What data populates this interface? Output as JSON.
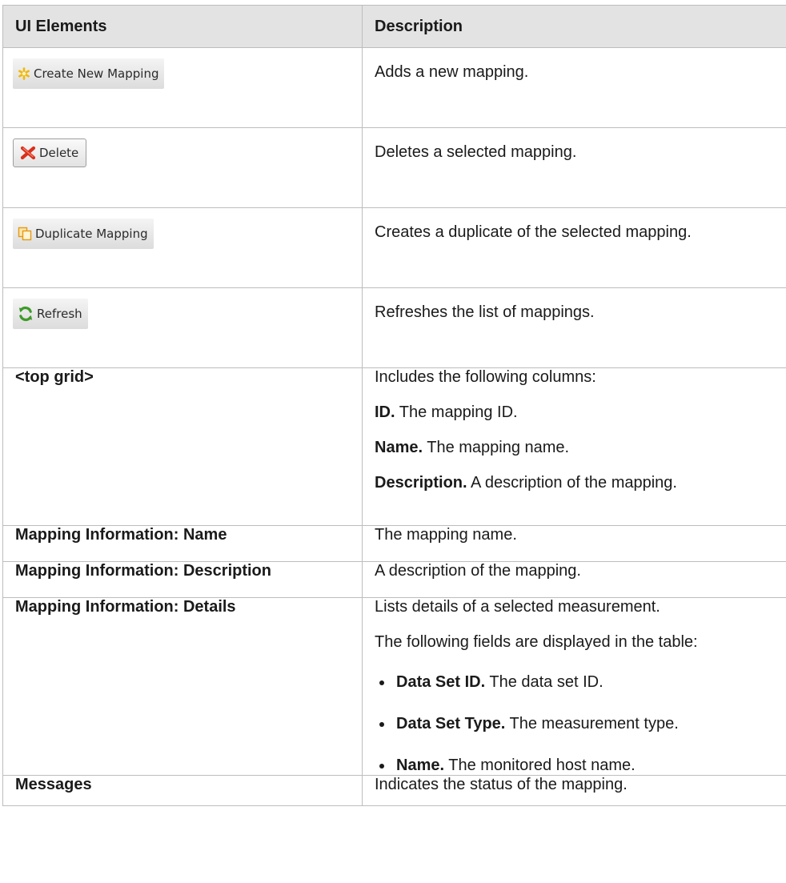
{
  "header": {
    "col1": "UI Elements",
    "col2": "Description"
  },
  "buttons": [
    {
      "label": "Create New Mapping",
      "icon": "asterisk-icon",
      "description": "Adds a new mapping."
    },
    {
      "label": "Delete",
      "icon": "delete-x-icon",
      "description": "Deletes a selected mapping."
    },
    {
      "label": "Duplicate Mapping",
      "icon": "duplicate-icon",
      "description": "Creates a duplicate of the selected mapping."
    },
    {
      "label": "Refresh",
      "icon": "refresh-icon",
      "description": "Refreshes the list of mappings."
    }
  ],
  "top_grid": {
    "element": "<top grid>",
    "intro": "Includes the following columns:",
    "columns": [
      {
        "term": "ID.",
        "text": " The mapping ID."
      },
      {
        "term": "Name.",
        "text": " The mapping name."
      },
      {
        "term": "Description.",
        "text": " A description of the mapping."
      }
    ]
  },
  "mapping_name": {
    "element": "Mapping Information: Name",
    "description": "The mapping name."
  },
  "mapping_description": {
    "element": "Mapping Information: Description",
    "description": "A description of the mapping."
  },
  "mapping_details": {
    "element": "Mapping Information: Details",
    "line1": "Lists details of a selected measurement.",
    "line2": "The following fields are displayed in the table:",
    "fields": [
      {
        "term": "Data Set ID.",
        "text": " The data set ID."
      },
      {
        "term": "Data Set Type.",
        "text": " The measurement type."
      },
      {
        "term": "Name.",
        "text": " The monitored host name."
      }
    ]
  },
  "messages": {
    "element": "Messages",
    "description": "Indicates the status of the mapping."
  },
  "colors": {
    "header_bg": "#e3e3e3",
    "border": "#bdbdbd",
    "asterisk": "#f2b705",
    "delete_x": "#d9301c",
    "duplicate": "#e49a12",
    "refresh": "#3f9a2a"
  }
}
